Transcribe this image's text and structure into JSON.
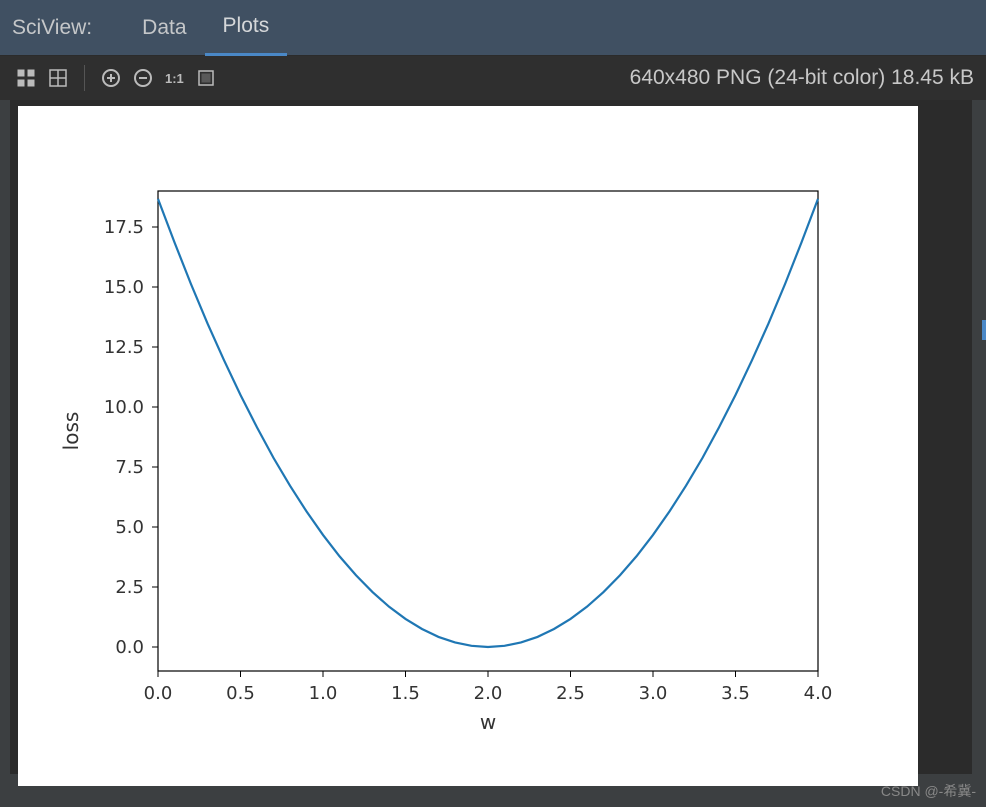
{
  "header": {
    "title": "SciView:",
    "tabs": [
      {
        "label": "Data",
        "active": false
      },
      {
        "label": "Plots",
        "active": true
      }
    ]
  },
  "toolbar": {
    "icons": [
      "fit",
      "grid",
      "zoom-in",
      "zoom-out",
      "1:1",
      "fullscreen"
    ],
    "info": "640x480 PNG (24-bit color) 18.45 kB"
  },
  "watermark": "CSDN @-希冀-",
  "chart_data": {
    "type": "line",
    "title": "",
    "xlabel": "w",
    "ylabel": "loss",
    "xlim": [
      0.0,
      4.0
    ],
    "ylim": [
      -1.0,
      19.0
    ],
    "xticks": [
      0.0,
      0.5,
      1.0,
      1.5,
      2.0,
      2.5,
      3.0,
      3.5,
      4.0
    ],
    "yticks": [
      0.0,
      2.5,
      5.0,
      7.5,
      10.0,
      12.5,
      15.0,
      17.5
    ],
    "x": [
      0.0,
      0.1,
      0.2,
      0.3,
      0.4,
      0.5,
      0.6,
      0.7,
      0.8,
      0.9,
      1.0,
      1.1,
      1.2,
      1.3,
      1.4,
      1.5,
      1.6,
      1.7,
      1.8,
      1.9,
      2.0,
      2.1,
      2.2,
      2.3,
      2.4,
      2.5,
      2.6,
      2.7,
      2.8,
      2.9,
      3.0,
      3.1,
      3.2,
      3.3,
      3.4,
      3.5,
      3.6,
      3.7,
      3.8,
      3.9,
      4.0
    ],
    "y": [
      18.67,
      16.86,
      15.12,
      13.48,
      11.95,
      10.5,
      9.15,
      7.88,
      6.72,
      5.65,
      4.67,
      3.78,
      2.99,
      2.29,
      1.68,
      1.17,
      0.75,
      0.42,
      0.19,
      0.05,
      0.0,
      0.05,
      0.19,
      0.42,
      0.75,
      1.17,
      1.68,
      2.29,
      2.99,
      3.78,
      4.67,
      5.65,
      6.72,
      7.88,
      9.15,
      10.5,
      11.95,
      13.48,
      15.12,
      16.86,
      18.67
    ],
    "line_color": "#1f77b4",
    "grid": false
  }
}
